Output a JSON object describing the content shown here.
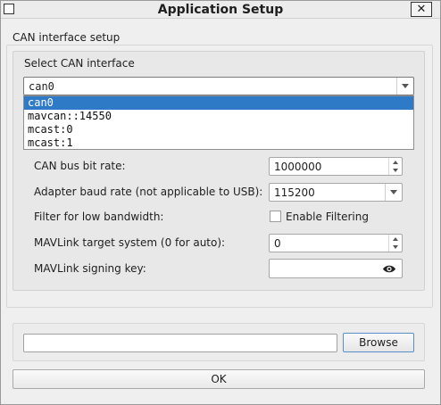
{
  "window": {
    "title": "Application Setup",
    "close_glyph": "✕"
  },
  "group": {
    "label": "CAN interface setup",
    "select_label": "Select CAN interface"
  },
  "interface_combo": {
    "value": "can0",
    "options": [
      "can0",
      "mavcan::14550",
      "mcast:0",
      "mcast:1"
    ],
    "selected_index": 0
  },
  "fields": {
    "bitrate_label": "CAN bus bit rate:",
    "bitrate_value": "1000000",
    "baud_label": "Adapter baud rate (not applicable to USB):",
    "baud_value": "115200",
    "filter_label": "Filter for low bandwidth:",
    "filter_checkbox_label": "Enable Filtering",
    "filter_checked": false,
    "target_label": "MAVLink target system (0 for auto):",
    "target_value": "0",
    "signing_label": "MAVLink signing key:",
    "signing_value": "",
    "signing_icon": "eye-icon"
  },
  "bottom": {
    "path_value": "",
    "browse_label": "Browse"
  },
  "ok_label": "OK",
  "colors": {
    "selection": "#2f7ac6",
    "background": "#efefef",
    "focus_border": "#5b8ec8"
  }
}
